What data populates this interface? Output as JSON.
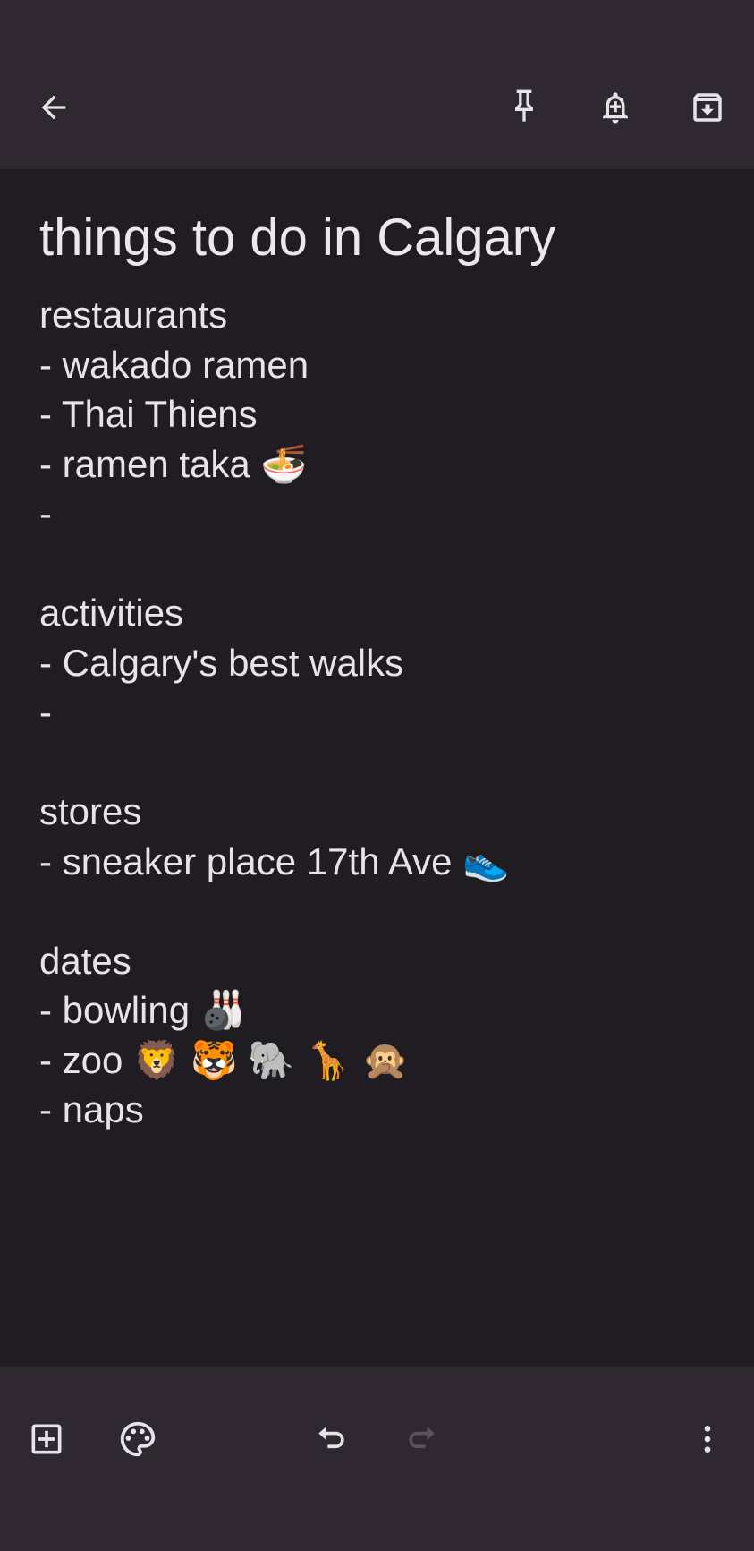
{
  "toolbar": {
    "back_icon": "arrow-left-icon",
    "pin_icon": "pin-icon",
    "reminder_icon": "bell-plus-icon",
    "archive_icon": "archive-icon"
  },
  "note": {
    "title": "things to do in Calgary",
    "body": "restaurants\n- wakado ramen\n- Thai Thiens\n- ramen taka 🍜\n-\n\nactivities\n- Calgary's best walks\n-\n\nstores\n- sneaker place 17th Ave 👟\n\ndates\n- bowling 🎳\n- zoo 🦁 🐯 🐘 🦒 🙊\n- naps"
  },
  "bottom_bar": {
    "add_icon": "add-box-icon",
    "palette_icon": "palette-icon",
    "undo_icon": "undo-icon",
    "redo_icon": "redo-icon",
    "more_icon": "more-vert-icon"
  },
  "colors": {
    "bar_background": "#302831",
    "note_background": "#201d22",
    "text": "#e8e3ea",
    "disabled_icon": "#5a535c"
  }
}
